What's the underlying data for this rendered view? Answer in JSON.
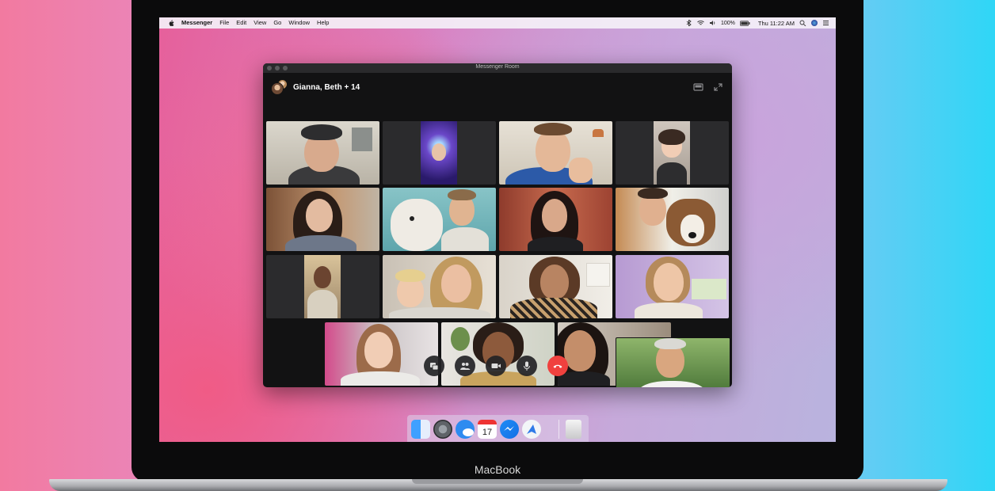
{
  "menubar": {
    "app_name": "Messenger",
    "items": [
      "File",
      "Edit",
      "View",
      "Go",
      "Window",
      "Help"
    ],
    "battery": "100%",
    "clock": "Thu 11:22 AM"
  },
  "window": {
    "title": "Messenger Room"
  },
  "room": {
    "title": "Gianna, Beth + 14"
  },
  "controls": [
    "screen-share",
    "participants",
    "video",
    "microphone",
    "end-call"
  ],
  "dock": [
    "finder",
    "system-preferences",
    "messages",
    "calendar",
    "messenger",
    "maps",
    "trash"
  ],
  "calendar_day": "17",
  "device": {
    "brand": "MacBook"
  },
  "colors": {
    "end_call": "#f0413e",
    "window_bg": "#121213"
  }
}
